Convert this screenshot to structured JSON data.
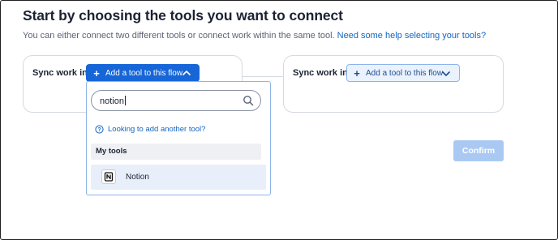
{
  "header": {
    "title": "Start by choosing the tools you want to connect",
    "subtitle": "You can either connect two different tools or connect work within the same tool.",
    "help_link": "Need some help selecting your tools?"
  },
  "left_card": {
    "label": "Sync work in",
    "add_button_label": "Add a tool to this flow",
    "add_button_icon": "plus-icon",
    "chevron_icon": "chevron-up-icon"
  },
  "right_card": {
    "label": "Sync work in",
    "add_button_label": "Add a tool to this flow",
    "add_button_icon": "plus-icon",
    "chevron_icon": "chevron-down-icon"
  },
  "dropdown": {
    "search_value": "notion",
    "search_icon": "search-icon",
    "help_link": "Looking to add another tool?",
    "help_icon": "question-circle-icon",
    "section_label": "My tools",
    "tools": [
      {
        "name": "Notion",
        "icon": "notion-icon"
      }
    ]
  },
  "confirm_button": {
    "label": "Confirm",
    "state": "disabled"
  },
  "colors": {
    "primary": "#1666d8",
    "link": "#1565c0",
    "confirm_disabled": "#a9c9f3",
    "selected_row": "#e8effa"
  }
}
